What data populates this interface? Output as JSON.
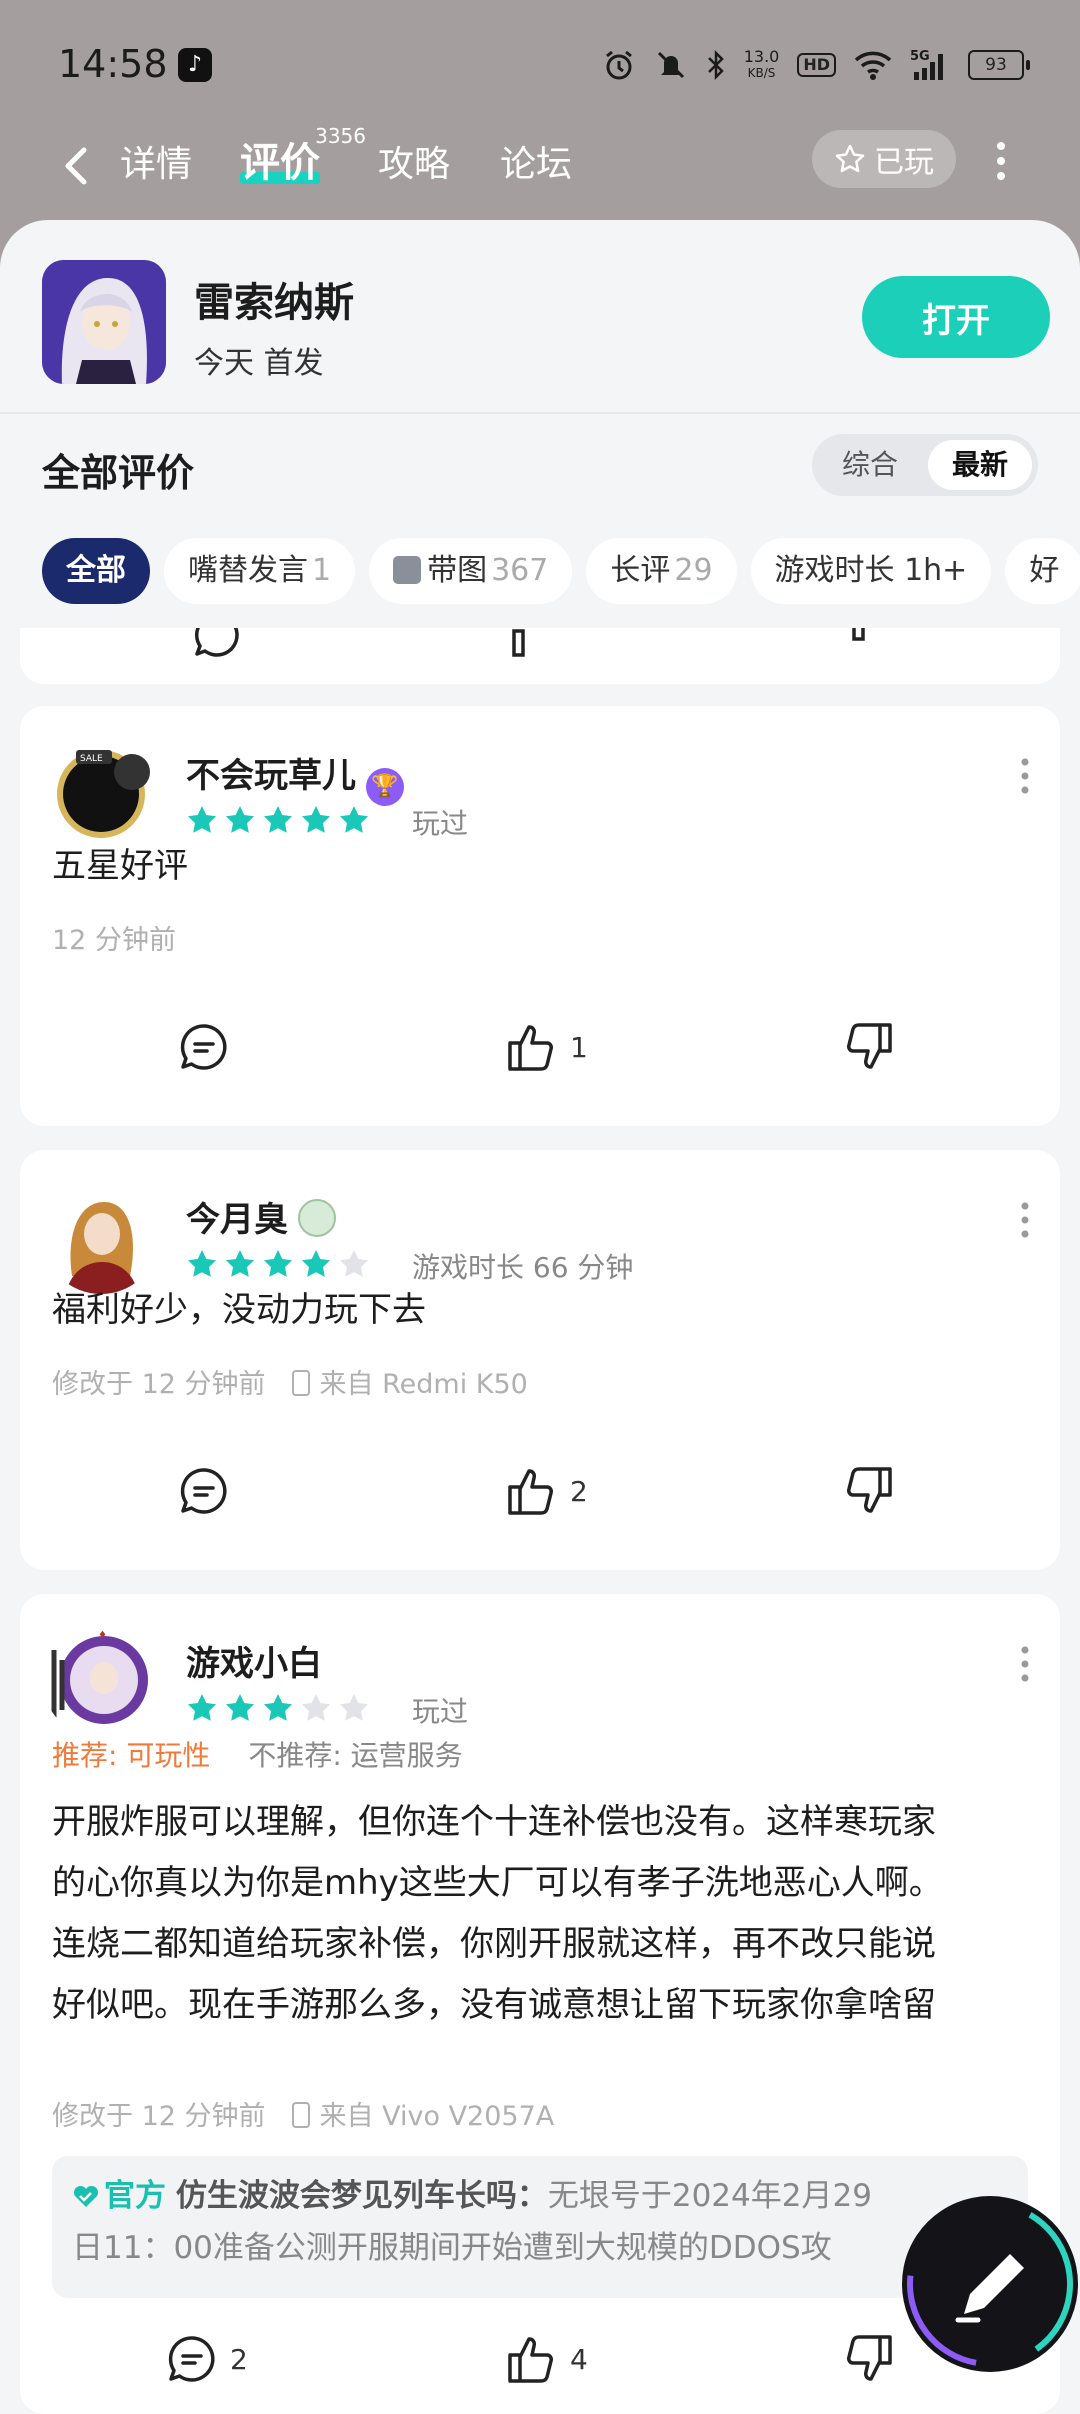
{
  "status": {
    "time": "14:58",
    "speed": "13.0",
    "speed_unit": "KB/S",
    "hd": "HD",
    "net": "5G",
    "battery": "93"
  },
  "nav": {
    "tabs": [
      {
        "label": "详情"
      },
      {
        "label": "评价",
        "badge": "3356"
      },
      {
        "label": "攻略"
      },
      {
        "label": "论坛"
      }
    ],
    "played_label": "已玩"
  },
  "app": {
    "name": "雷索纳斯",
    "subtitle": "今天 首发",
    "open_label": "打开"
  },
  "reviews_section": {
    "title": "全部评价",
    "sort_options": [
      "综合",
      "最新"
    ],
    "selected_sort": "最新",
    "filters": [
      {
        "label": "全部",
        "count": ""
      },
      {
        "label": "嘴替发言",
        "count": "1"
      },
      {
        "label": "带图",
        "count": "367"
      },
      {
        "label": "长评",
        "count": "29"
      },
      {
        "label": "游戏时长 1h+",
        "count": ""
      },
      {
        "label": "好",
        "count": ""
      }
    ]
  },
  "reviews": [
    {
      "user": "不会玩草儿",
      "badge": "trophy",
      "rating": 5,
      "meta": "玩过",
      "text": "五星好评",
      "time": "12 分钟前",
      "device": "",
      "comments": "",
      "likes": "1"
    },
    {
      "user": "今月臭",
      "badge": "green",
      "rating": 4,
      "meta": "游戏时长 66 分钟",
      "text": "福利好少，没动力玩下去",
      "time": "修改于 12 分钟前",
      "device": "来自 Redmi K50",
      "comments": "",
      "likes": "2"
    },
    {
      "user": "游戏小白",
      "rating": 3,
      "meta": "玩过",
      "recommend": "推荐: 可玩性",
      "not_recommend": "不推荐: 运营服务",
      "text_lines": [
        "开服炸服可以理解，但你连个十连补偿也没有。这样寒玩家",
        "的心你真以为你是mhy这些大厂可以有孝子洗地恶心人啊。",
        "连烧二都知道给玩家补偿，你刚开服就这样，再不改只能说",
        "好似吧。现在手游那么多，没有诚意想让留下玩家你拿啥留"
      ],
      "time": "修改于 12 分钟前",
      "device": "来自 Vivo V2057A",
      "official": {
        "tag": "官方",
        "author": "仿生波波会梦见列车长吗：",
        "line1": "无垠号于2024年2月29",
        "line2": "日11：00准备公测开服期间开始遭到大规模的DDOS攻"
      },
      "comments": "2",
      "likes": "4"
    }
  ],
  "colors": {
    "accent": "#1ccfb9",
    "star": "#19c8b6",
    "chip_active": "#1a2a6c",
    "recommend": "#f07a3a"
  }
}
